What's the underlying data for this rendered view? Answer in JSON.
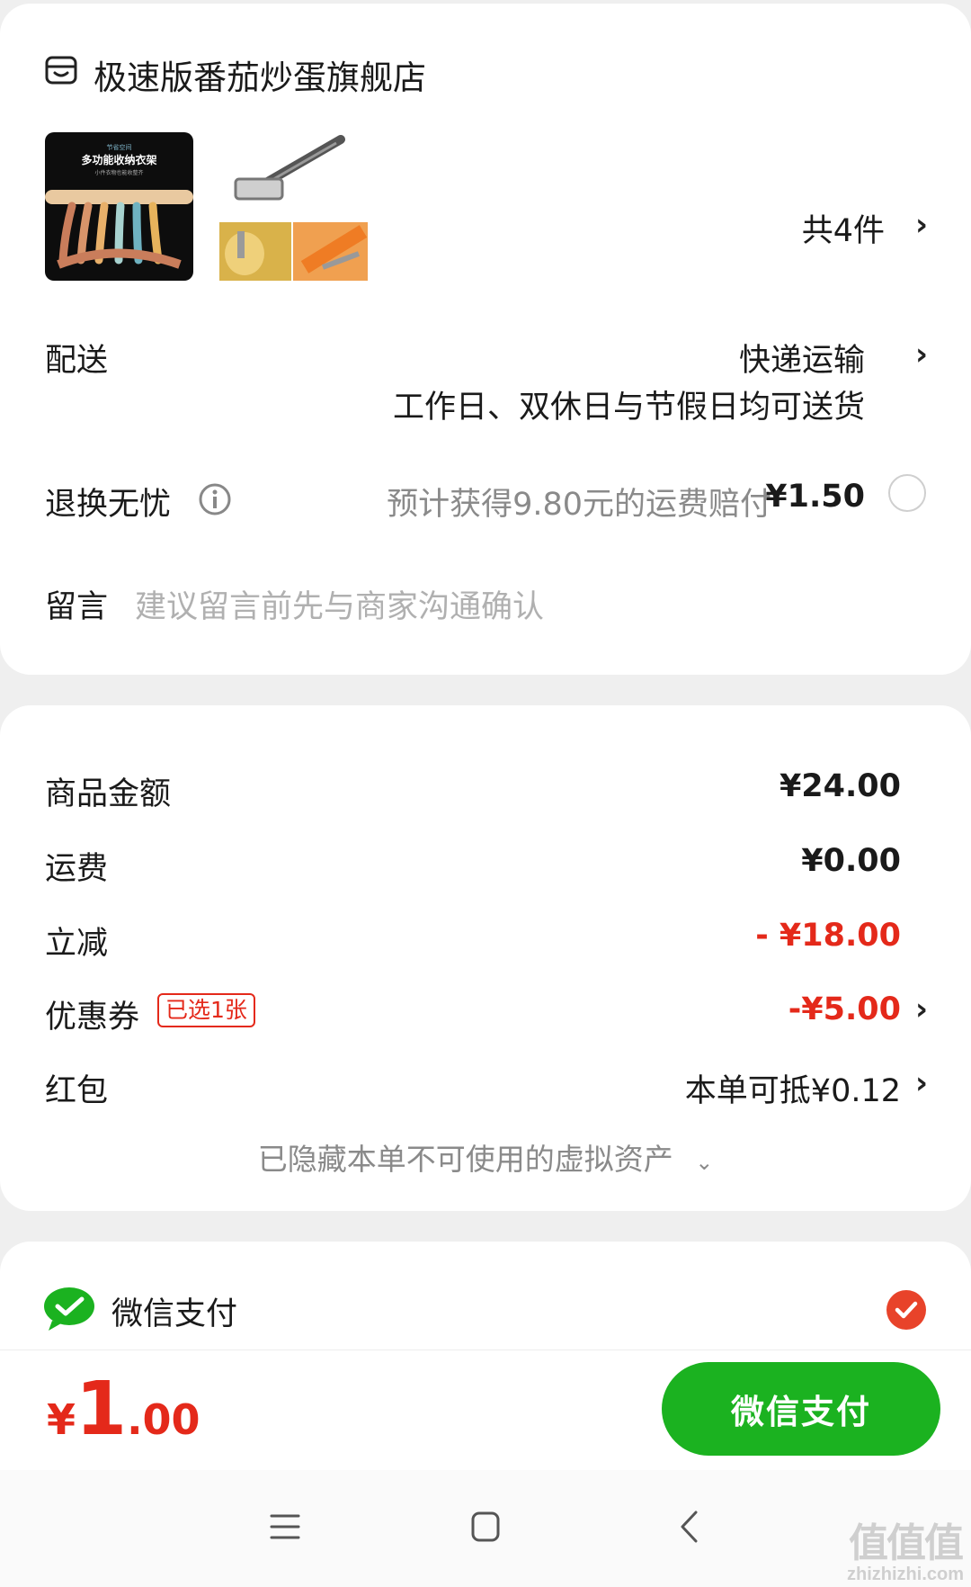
{
  "store": {
    "name": "极速版番茄炒蛋旗舰店",
    "icon": "store-icon"
  },
  "products": {
    "thumb1_caption_top": "节省空间",
    "thumb1_title": "多功能收纳衣架",
    "thumb1_sub": "小件衣物也能收整齐",
    "count_label": "共4件"
  },
  "delivery": {
    "label": "配送",
    "method": "快递运输",
    "note": "工作日、双休日与节假日均可送货"
  },
  "return": {
    "label": "退换无忧",
    "info_icon": "info-icon",
    "desc": "预计获得9.80元的运费赔付",
    "price": "¥1.50"
  },
  "message": {
    "label": "留言",
    "placeholder": "建议留言前先与商家沟通确认"
  },
  "price_summary": {
    "goods_label": "商品金额",
    "goods_value": "¥24.00",
    "shipping_label": "运费",
    "shipping_value": "¥0.00",
    "discount_label": "立减",
    "discount_value": "- ¥18.00",
    "coupon_label": "优惠券",
    "coupon_badge": "已选1张",
    "coupon_value": "-¥5.00",
    "redpacket_label": "红包",
    "redpacket_value": "本单可抵¥0.12",
    "hidden_assets": "已隐藏本单不可使用的虚拟资产"
  },
  "payment": {
    "method_label": "微信支付",
    "icon": "wechat-pay-icon",
    "selected": true
  },
  "checkout": {
    "currency": "¥",
    "amount_int": "1",
    "amount_dec": ".00",
    "button_label": "微信支付"
  },
  "watermark": {
    "text": "值值值",
    "domain": "zhizhizhi.com"
  },
  "colors": {
    "accent_red": "#e4291a",
    "wechat_green": "#1bb220",
    "text_primary": "#1a1a1a",
    "text_secondary": "#8a8a8a"
  }
}
